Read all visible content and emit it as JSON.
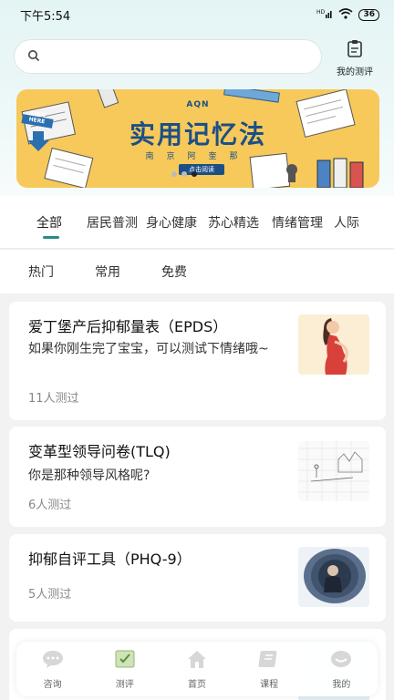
{
  "status_bar": {
    "time": "下午5:54",
    "network": "HD",
    "battery": "36"
  },
  "search": {
    "placeholder": "",
    "value": ""
  },
  "my_evaluation": {
    "label": "我的测评"
  },
  "banner": {
    "brand": "AQN",
    "title": "实用记忆法",
    "subtitle": "南京阿奎那",
    "cta": "点击阅读",
    "sign": "SIGN HERE",
    "page_count": 3,
    "active_page": 2
  },
  "categories": [
    {
      "label": "全部",
      "active": true
    },
    {
      "label": "居民普测"
    },
    {
      "label": "身心健康"
    },
    {
      "label": "苏心精选"
    },
    {
      "label": "情绪管理"
    },
    {
      "label": "人际"
    }
  ],
  "filters": [
    "热门",
    "常用",
    "免费"
  ],
  "cards": [
    {
      "title": "爱丁堡产后抑郁量表（EPDS）",
      "desc": "如果你刚生完了宝宝，可以测试下情绪哦~",
      "count": "11人测过",
      "thumb": "pregnant-woman"
    },
    {
      "title": "变革型领导问卷(TLQ)",
      "desc": "你是那种领导风格呢?",
      "count": "6人测过",
      "thumb": "sketch-crowd"
    },
    {
      "title": "抑郁自评工具（PHQ-9）",
      "desc": "",
      "count": "5人测过",
      "thumb": "sad-person"
    }
  ],
  "tabbar": [
    {
      "label": "咨询",
      "icon": "chat-bubble-icon"
    },
    {
      "label": "测评",
      "icon": "assessment-icon"
    },
    {
      "label": "首页",
      "icon": "home-icon"
    },
    {
      "label": "课程",
      "icon": "book-icon"
    },
    {
      "label": "我的",
      "icon": "profile-icon"
    }
  ],
  "colors": {
    "accent": "#2a8c82",
    "banner_bg": "#f7c95a",
    "banner_text": "#1c4f86"
  }
}
